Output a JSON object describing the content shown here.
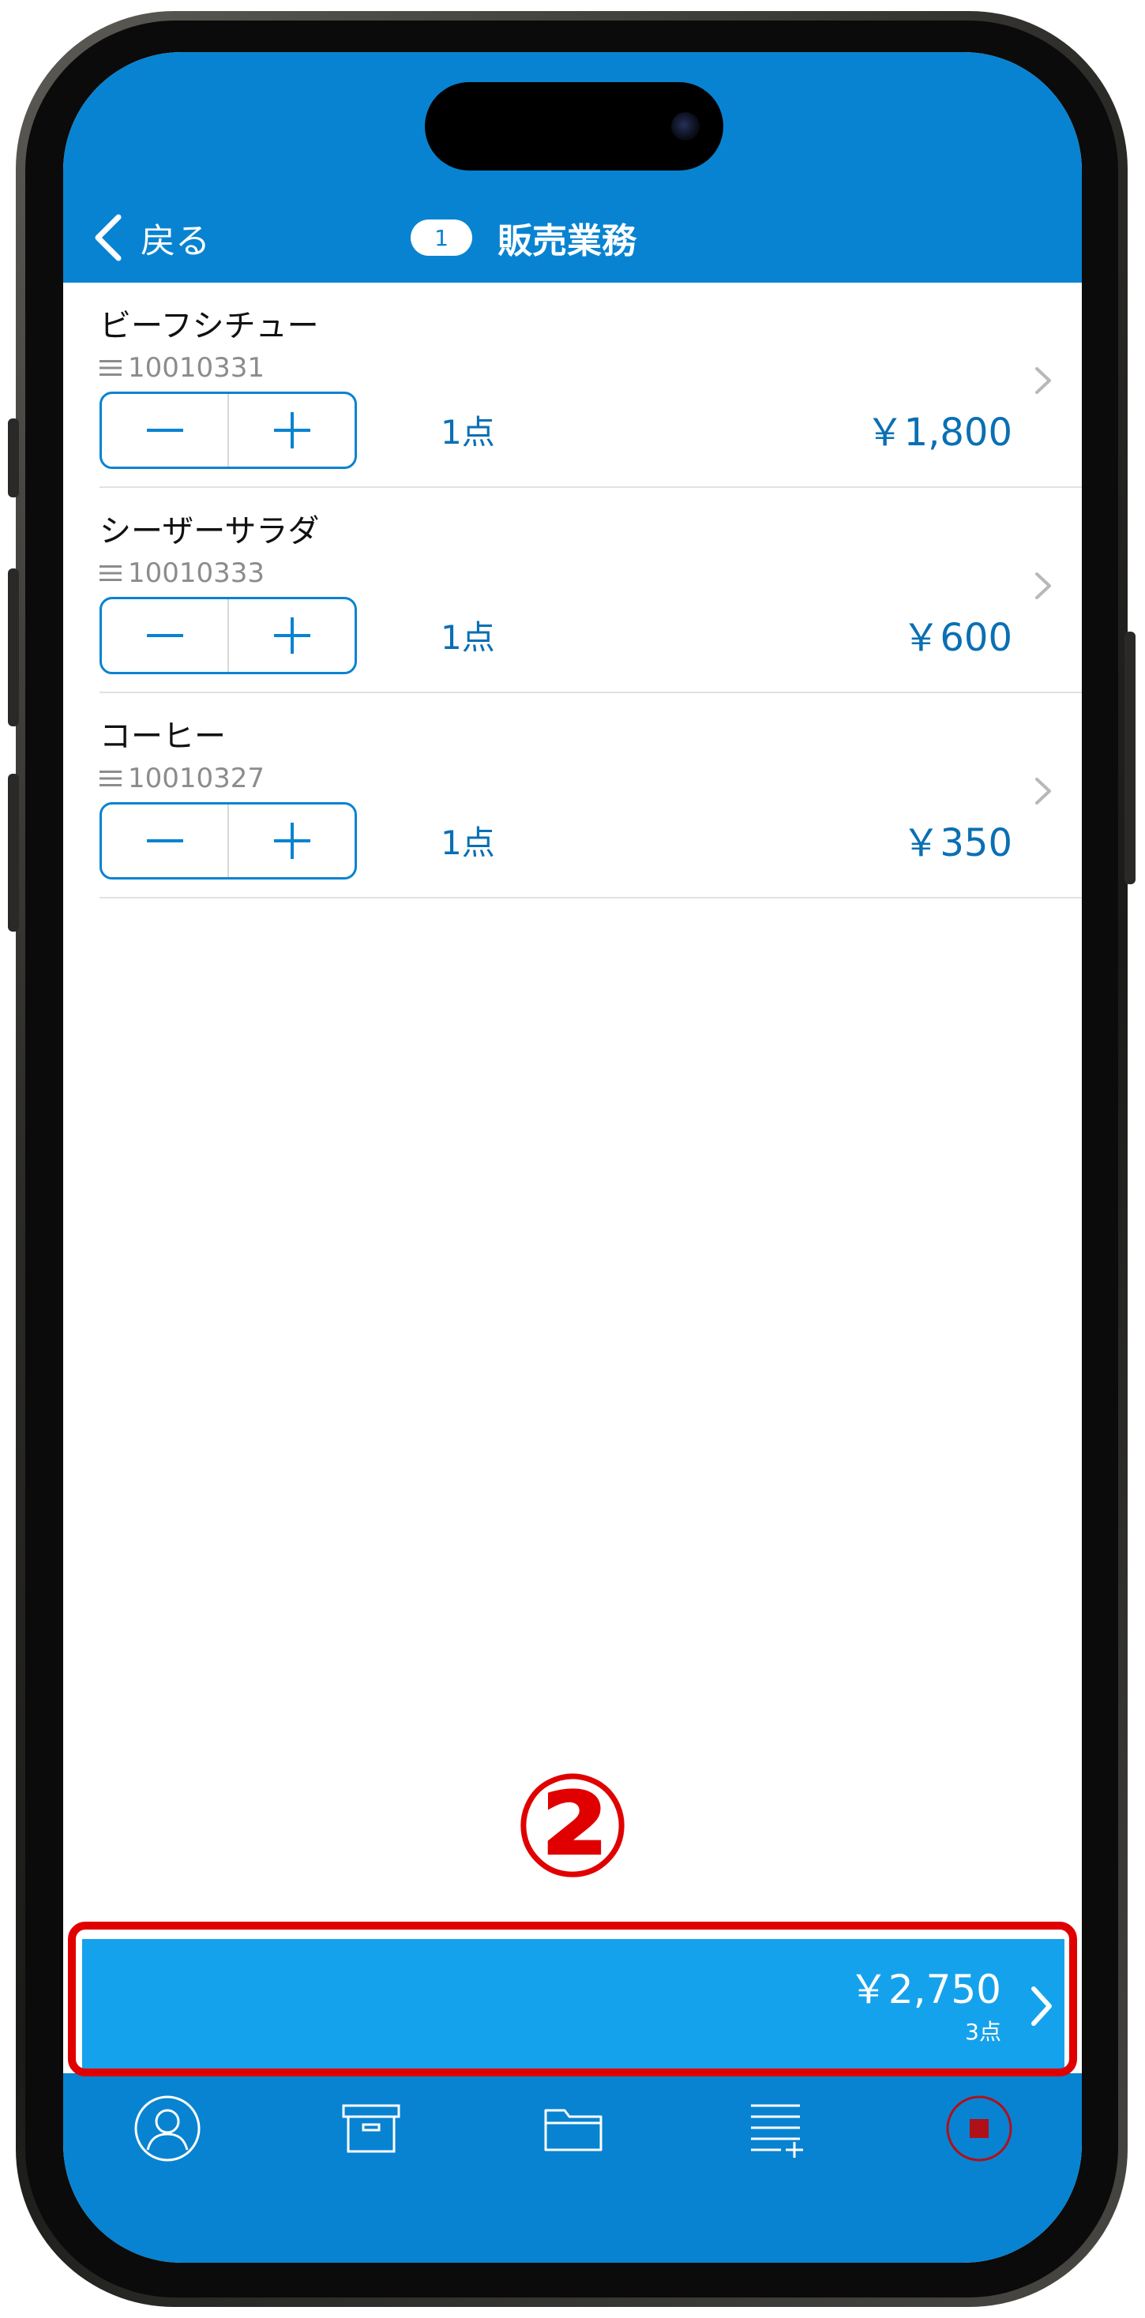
{
  "nav": {
    "back_label": "戻る",
    "badge_count": "1",
    "title": "販売業務"
  },
  "items": [
    {
      "name": "ビーフシチュー",
      "code": "10010331",
      "quantity": "1点",
      "price": "￥1,800"
    },
    {
      "name": "シーザーサラダ",
      "code": "10010333",
      "quantity": "1点",
      "price": "￥600"
    },
    {
      "name": "コーヒー",
      "code": "10010327",
      "quantity": "1点",
      "price": "￥350"
    }
  ],
  "annotation": {
    "label": "②"
  },
  "total": {
    "amount": "￥2,750",
    "count": "3点"
  },
  "tabbar": {
    "icons": [
      "person-icon",
      "archive-box-icon",
      "folder-icon",
      "list-add-icon",
      "stop-icon"
    ]
  },
  "colors": {
    "brand_blue": "#0883d1",
    "total_bar": "#15a2ec",
    "price_text": "#0a6fb4",
    "highlight": "#e00000",
    "stop_red": "#b0101a"
  }
}
